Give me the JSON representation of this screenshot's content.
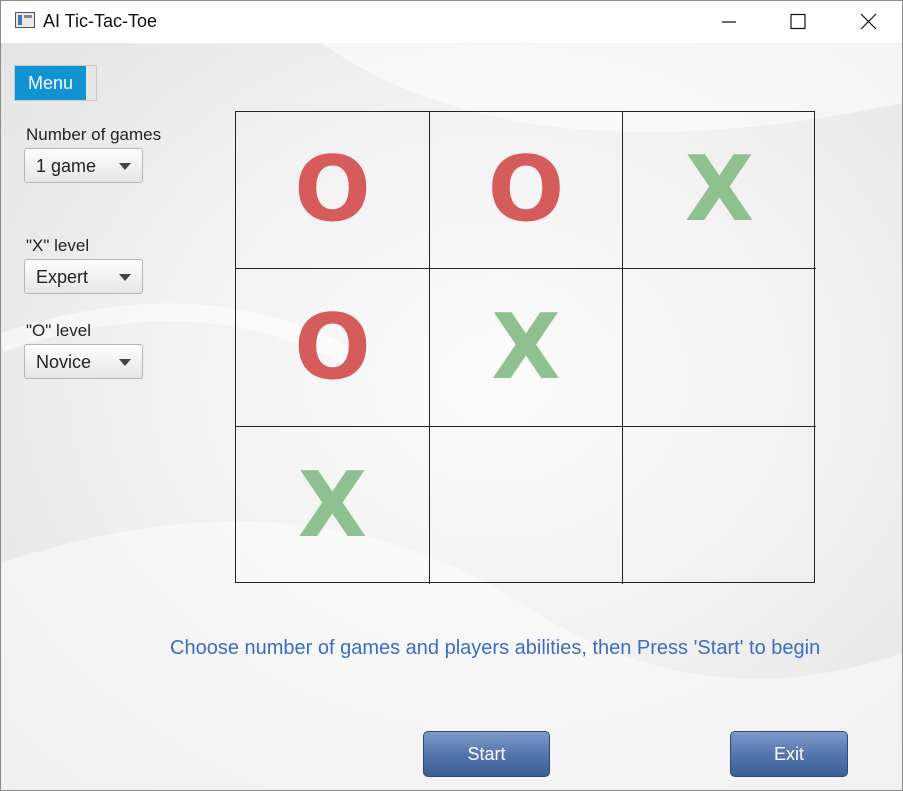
{
  "window": {
    "title": "AI Tic-Tac-Toe",
    "app_icon": "window-app-icon",
    "controls": [
      "minimize-icon",
      "maximize-icon",
      "close-icon"
    ]
  },
  "menu": {
    "label": "Menu"
  },
  "settings": {
    "games": {
      "label": "Number of games",
      "value": "1 game"
    },
    "x_level": {
      "label": "\"X\" level",
      "value": "Expert"
    },
    "o_level": {
      "label": "\"O\" level",
      "value": "Novice"
    }
  },
  "board": {
    "cells": [
      [
        "O",
        "O",
        "X"
      ],
      [
        "O",
        "X",
        ""
      ],
      [
        "X",
        "",
        ""
      ]
    ]
  },
  "status": "Choose number of games and players abilities, then Press 'Start' to begin",
  "buttons": {
    "start": "Start",
    "exit": "Exit"
  },
  "colors": {
    "o_mark": "#d65b5b",
    "x_mark": "#8fc08f",
    "status_text": "#3c6cc4",
    "menu_accent": "#1293d1",
    "button": "#5476ad"
  }
}
